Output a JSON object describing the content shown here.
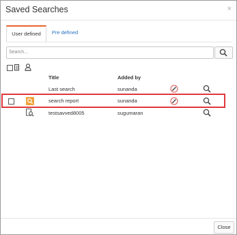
{
  "dialog": {
    "title": "Saved Searches",
    "close_glyph": "×"
  },
  "tabs": [
    {
      "label": "User defined",
      "active": true
    },
    {
      "label": "Pre defined",
      "active": false
    }
  ],
  "search": {
    "placeholder": "Search...",
    "value": "",
    "button_icon": "magnifier-icon"
  },
  "toolbar": {
    "icons": [
      "select-all-checkbox",
      "document-icon",
      "user-icon"
    ]
  },
  "table": {
    "columns": [
      "Title",
      "Added by"
    ],
    "rows": [
      {
        "checkbox": false,
        "type_icon": "",
        "title": "Last search",
        "added_by": "sunanda",
        "editable": true,
        "highlighted": false
      },
      {
        "checkbox": true,
        "type_icon": "report-search-icon",
        "title": "search report",
        "added_by": "sunanda",
        "editable": true,
        "highlighted": true
      },
      {
        "checkbox": false,
        "type_icon": "doc-search-icon",
        "title": "testsavved8005",
        "added_by": "sugumaran",
        "editable": false,
        "highlighted": false
      }
    ]
  },
  "footer": {
    "close_label": "Close"
  },
  "colors": {
    "tab_accent": "#e8632c",
    "link": "#2a72c4",
    "highlight_border": "#e0363b",
    "report_icon_bg": "#f0a23c",
    "edit_icon": "#d9534f"
  }
}
